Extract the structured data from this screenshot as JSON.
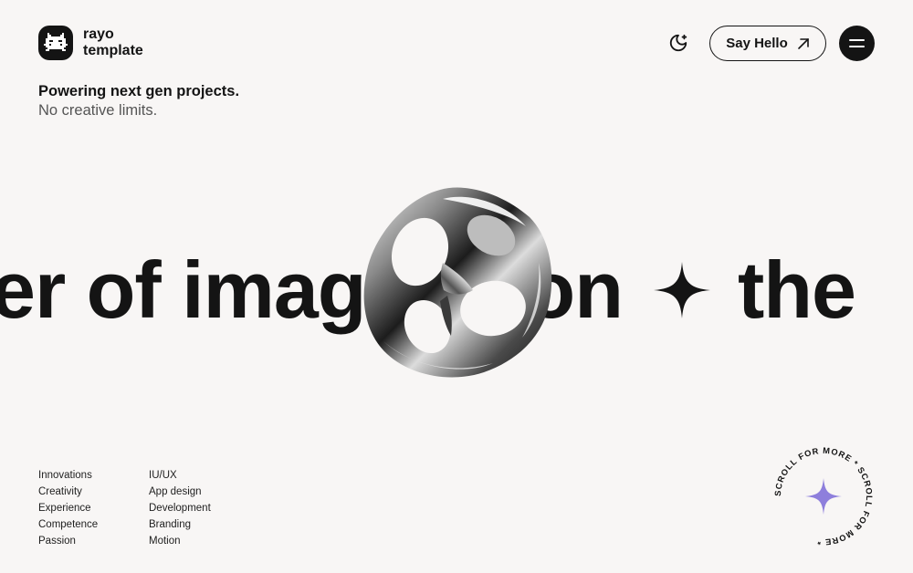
{
  "brand": {
    "name_line1": "rayo",
    "name_line2": "template"
  },
  "header": {
    "cta_label": "Say Hello",
    "theme_icon": "moon-stars-icon",
    "menu_icon": "hamburger-icon"
  },
  "hero": {
    "line1": "Powering next gen projects.",
    "line2": "No creative limits."
  },
  "marquee": {
    "text_before": "er of imagination",
    "text_after": "the"
  },
  "lists": {
    "col1": [
      "Innovations",
      "Creativity",
      "Experience",
      "Competence",
      "Passion"
    ],
    "col2": [
      "IU/UX",
      "App design",
      "Development",
      "Branding",
      "Motion"
    ]
  },
  "scroll_badge": {
    "text": "SCROLL FOR MORE * SCROLL FOR MORE * ",
    "star_color": "#8e7fdc"
  },
  "colors": {
    "background": "#f8f6f5",
    "ink": "#141414",
    "accent": "#8e7fdc"
  }
}
